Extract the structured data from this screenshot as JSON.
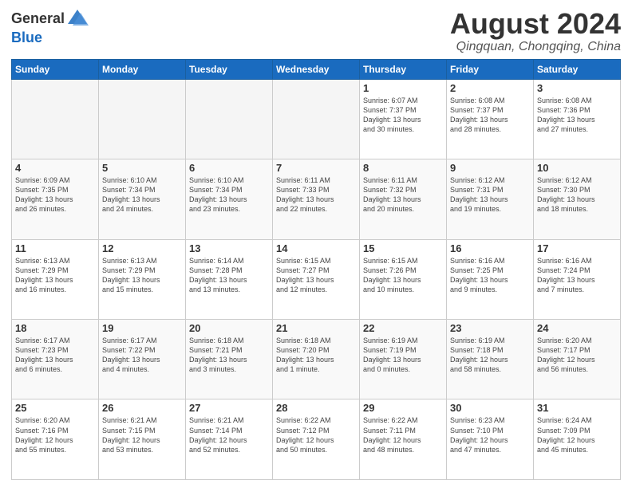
{
  "header": {
    "logo_text_general": "General",
    "logo_text_blue": "Blue",
    "month_title": "August 2024",
    "location": "Qingquan, Chongqing, China"
  },
  "calendar": {
    "days_of_week": [
      "Sunday",
      "Monday",
      "Tuesday",
      "Wednesday",
      "Thursday",
      "Friday",
      "Saturday"
    ],
    "weeks": [
      [
        {
          "day": "",
          "info": ""
        },
        {
          "day": "",
          "info": ""
        },
        {
          "day": "",
          "info": ""
        },
        {
          "day": "",
          "info": ""
        },
        {
          "day": "1",
          "info": "Sunrise: 6:07 AM\nSunset: 7:37 PM\nDaylight: 13 hours\nand 30 minutes."
        },
        {
          "day": "2",
          "info": "Sunrise: 6:08 AM\nSunset: 7:37 PM\nDaylight: 13 hours\nand 28 minutes."
        },
        {
          "day": "3",
          "info": "Sunrise: 6:08 AM\nSunset: 7:36 PM\nDaylight: 13 hours\nand 27 minutes."
        }
      ],
      [
        {
          "day": "4",
          "info": "Sunrise: 6:09 AM\nSunset: 7:35 PM\nDaylight: 13 hours\nand 26 minutes."
        },
        {
          "day": "5",
          "info": "Sunrise: 6:10 AM\nSunset: 7:34 PM\nDaylight: 13 hours\nand 24 minutes."
        },
        {
          "day": "6",
          "info": "Sunrise: 6:10 AM\nSunset: 7:34 PM\nDaylight: 13 hours\nand 23 minutes."
        },
        {
          "day": "7",
          "info": "Sunrise: 6:11 AM\nSunset: 7:33 PM\nDaylight: 13 hours\nand 22 minutes."
        },
        {
          "day": "8",
          "info": "Sunrise: 6:11 AM\nSunset: 7:32 PM\nDaylight: 13 hours\nand 20 minutes."
        },
        {
          "day": "9",
          "info": "Sunrise: 6:12 AM\nSunset: 7:31 PM\nDaylight: 13 hours\nand 19 minutes."
        },
        {
          "day": "10",
          "info": "Sunrise: 6:12 AM\nSunset: 7:30 PM\nDaylight: 13 hours\nand 18 minutes."
        }
      ],
      [
        {
          "day": "11",
          "info": "Sunrise: 6:13 AM\nSunset: 7:29 PM\nDaylight: 13 hours\nand 16 minutes."
        },
        {
          "day": "12",
          "info": "Sunrise: 6:13 AM\nSunset: 7:29 PM\nDaylight: 13 hours\nand 15 minutes."
        },
        {
          "day": "13",
          "info": "Sunrise: 6:14 AM\nSunset: 7:28 PM\nDaylight: 13 hours\nand 13 minutes."
        },
        {
          "day": "14",
          "info": "Sunrise: 6:15 AM\nSunset: 7:27 PM\nDaylight: 13 hours\nand 12 minutes."
        },
        {
          "day": "15",
          "info": "Sunrise: 6:15 AM\nSunset: 7:26 PM\nDaylight: 13 hours\nand 10 minutes."
        },
        {
          "day": "16",
          "info": "Sunrise: 6:16 AM\nSunset: 7:25 PM\nDaylight: 13 hours\nand 9 minutes."
        },
        {
          "day": "17",
          "info": "Sunrise: 6:16 AM\nSunset: 7:24 PM\nDaylight: 13 hours\nand 7 minutes."
        }
      ],
      [
        {
          "day": "18",
          "info": "Sunrise: 6:17 AM\nSunset: 7:23 PM\nDaylight: 13 hours\nand 6 minutes."
        },
        {
          "day": "19",
          "info": "Sunrise: 6:17 AM\nSunset: 7:22 PM\nDaylight: 13 hours\nand 4 minutes."
        },
        {
          "day": "20",
          "info": "Sunrise: 6:18 AM\nSunset: 7:21 PM\nDaylight: 13 hours\nand 3 minutes."
        },
        {
          "day": "21",
          "info": "Sunrise: 6:18 AM\nSunset: 7:20 PM\nDaylight: 13 hours\nand 1 minute."
        },
        {
          "day": "22",
          "info": "Sunrise: 6:19 AM\nSunset: 7:19 PM\nDaylight: 13 hours\nand 0 minutes."
        },
        {
          "day": "23",
          "info": "Sunrise: 6:19 AM\nSunset: 7:18 PM\nDaylight: 12 hours\nand 58 minutes."
        },
        {
          "day": "24",
          "info": "Sunrise: 6:20 AM\nSunset: 7:17 PM\nDaylight: 12 hours\nand 56 minutes."
        }
      ],
      [
        {
          "day": "25",
          "info": "Sunrise: 6:20 AM\nSunset: 7:16 PM\nDaylight: 12 hours\nand 55 minutes."
        },
        {
          "day": "26",
          "info": "Sunrise: 6:21 AM\nSunset: 7:15 PM\nDaylight: 12 hours\nand 53 minutes."
        },
        {
          "day": "27",
          "info": "Sunrise: 6:21 AM\nSunset: 7:14 PM\nDaylight: 12 hours\nand 52 minutes."
        },
        {
          "day": "28",
          "info": "Sunrise: 6:22 AM\nSunset: 7:12 PM\nDaylight: 12 hours\nand 50 minutes."
        },
        {
          "day": "29",
          "info": "Sunrise: 6:22 AM\nSunset: 7:11 PM\nDaylight: 12 hours\nand 48 minutes."
        },
        {
          "day": "30",
          "info": "Sunrise: 6:23 AM\nSunset: 7:10 PM\nDaylight: 12 hours\nand 47 minutes."
        },
        {
          "day": "31",
          "info": "Sunrise: 6:24 AM\nSunset: 7:09 PM\nDaylight: 12 hours\nand 45 minutes."
        }
      ]
    ]
  }
}
